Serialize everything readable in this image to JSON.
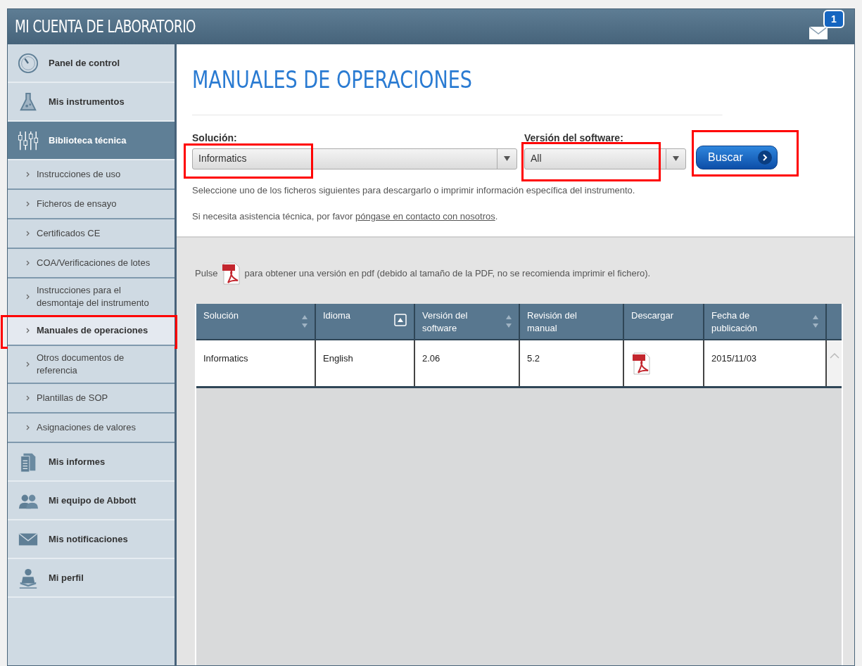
{
  "header": {
    "title": "MI CUENTA DE LABORATORIO",
    "notifications_badge": "1"
  },
  "sidebar": {
    "items": [
      {
        "kind": "main",
        "label": "Panel de control",
        "selected": false,
        "highlighted": false
      },
      {
        "kind": "main",
        "label": "Mis instrumentos",
        "selected": false,
        "highlighted": false
      },
      {
        "kind": "main",
        "label": "Biblioteca técnica",
        "selected": true,
        "highlighted": false
      },
      {
        "kind": "sub",
        "label": "Instrucciones de uso",
        "selected": false,
        "highlighted": false
      },
      {
        "kind": "sub",
        "label": "Ficheros de ensayo",
        "selected": false,
        "highlighted": false
      },
      {
        "kind": "sub",
        "label": "Certificados CE",
        "selected": false,
        "highlighted": false
      },
      {
        "kind": "sub",
        "label": "COA/Verificaciones de lotes",
        "selected": false,
        "highlighted": false
      },
      {
        "kind": "sub",
        "label": "Instrucciones para el desmontaje del instrumento",
        "selected": false,
        "highlighted": false
      },
      {
        "kind": "sub",
        "label": "Manuales de operaciones",
        "selected": true,
        "highlighted": true
      },
      {
        "kind": "sub",
        "label": "Otros documentos de referencia",
        "selected": false,
        "highlighted": false
      },
      {
        "kind": "sub",
        "label": "Plantillas de SOP",
        "selected": false,
        "highlighted": false
      },
      {
        "kind": "sub",
        "label": "Asignaciones de valores",
        "selected": false,
        "highlighted": false
      },
      {
        "kind": "main",
        "label": "Mis informes",
        "selected": false,
        "highlighted": false
      },
      {
        "kind": "main",
        "label": "Mi equipo de Abbott",
        "selected": false,
        "highlighted": false
      },
      {
        "kind": "main",
        "label": "Mis notificaciones",
        "selected": false,
        "highlighted": false
      },
      {
        "kind": "main",
        "label": "Mi perfil",
        "selected": false,
        "highlighted": false
      }
    ]
  },
  "page": {
    "title": "MANUALES DE OPERACIONES",
    "filters": [
      {
        "label": "Solución:",
        "value": "Informatics",
        "highlighted": true
      },
      {
        "label": "Versión del software:",
        "value": "All",
        "highlighted": true
      }
    ],
    "search_button": {
      "label": "Buscar",
      "highlighted": true
    },
    "intro": "Seleccione uno de los ficheros siguientes para descargarlo o imprimir información específica del instrumento.",
    "help": {
      "before": "Si necesita asistencia técnica, por favor ",
      "link": "póngase en contacto con nosotros",
      "after": "."
    },
    "pdf_note": {
      "before": "Pulse",
      "after": "para obtener una versión en pdf (debido al tamaño de la PDF, no se recomienda imprimir el fichero)."
    }
  },
  "table": {
    "columns": [
      {
        "label": "Solución",
        "kind": "sortable"
      },
      {
        "label": "Idioma",
        "kind": "sorted"
      },
      {
        "label": "Versión del software",
        "kind": "sortable"
      },
      {
        "label": "Revisión del manual",
        "kind": "plain"
      },
      {
        "label": "Descargar",
        "kind": "plain"
      },
      {
        "label": "Fecha de publicación",
        "kind": "sortable"
      }
    ],
    "rows": [
      [
        {
          "kind": "text",
          "text": "Informatics"
        },
        {
          "kind": "text",
          "text": "English"
        },
        {
          "kind": "text",
          "text": "2.06"
        },
        {
          "kind": "text",
          "text": "5.2"
        },
        {
          "kind": "pdf"
        },
        {
          "kind": "text",
          "text": "2015/11/03"
        }
      ]
    ]
  }
}
